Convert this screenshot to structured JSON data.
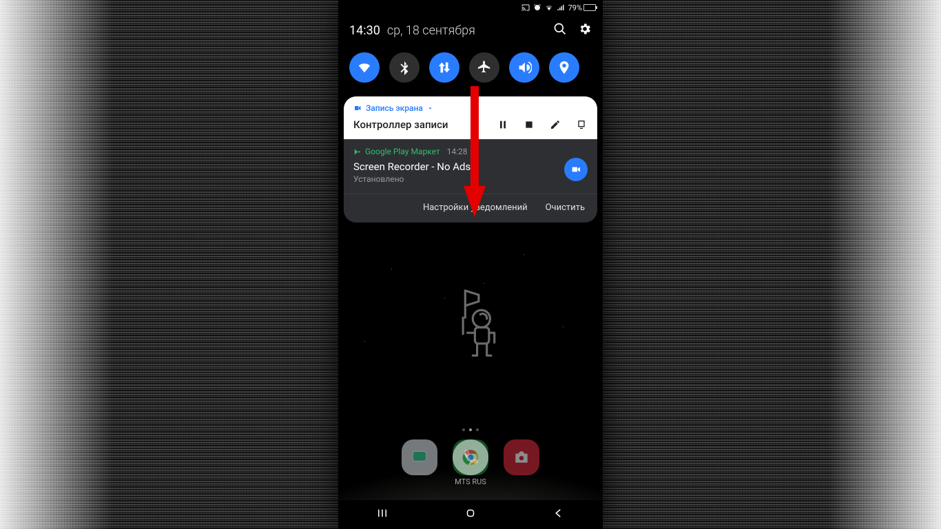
{
  "status": {
    "battery_pct": "79%"
  },
  "header": {
    "time": "14:30",
    "date": "ср, 18 сентября"
  },
  "qs": [
    {
      "name": "wifi",
      "on": true
    },
    {
      "name": "bluetooth",
      "on": false
    },
    {
      "name": "data",
      "on": true
    },
    {
      "name": "airplane",
      "on": false
    },
    {
      "name": "volume",
      "on": true
    },
    {
      "name": "location",
      "on": true
    }
  ],
  "notif_record": {
    "tag": "Запись экрана",
    "title": "Контроллер записи"
  },
  "notif_play": {
    "tag": "Google Play Маркет",
    "time": "14:28",
    "title": "Screen Recorder - No Ads",
    "sub": "Установлено"
  },
  "footer": {
    "settings": "Настройки уведомлений",
    "clear": "Очистить"
  },
  "carrier": "MTS RUS"
}
